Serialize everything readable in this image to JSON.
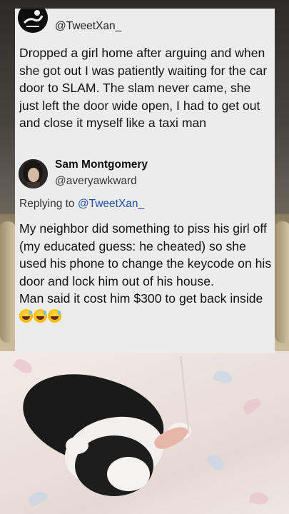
{
  "tweet": {
    "handle": "@TweetXan_",
    "text": "Dropped a girl home after arguing and when she got out I was patiently waiting for the car door to SLAM. The slam never came, she just left the door wide open, I had to get out and close it myself like a taxi man"
  },
  "reply": {
    "display_name": "Sam Montgomery",
    "handle": "@averyawkward",
    "replying_prefix": "Replying to ",
    "replying_to": "@TweetXan_",
    "text": "My neighbor did something to piss his girl off (my educated guess: he cheated) so she used his phone to change the keycode on his door and lock him out of his house.",
    "text_2": "Man said it cost him $300 to get back inside",
    "emojis": [
      "grinning-sweat-emoji",
      "grinning-sweat-emoji",
      "grinning-sweat-emoji"
    ]
  },
  "colors": {
    "card_bg": "#ececec",
    "mention": "#1d4fa0",
    "text": "#111111"
  }
}
